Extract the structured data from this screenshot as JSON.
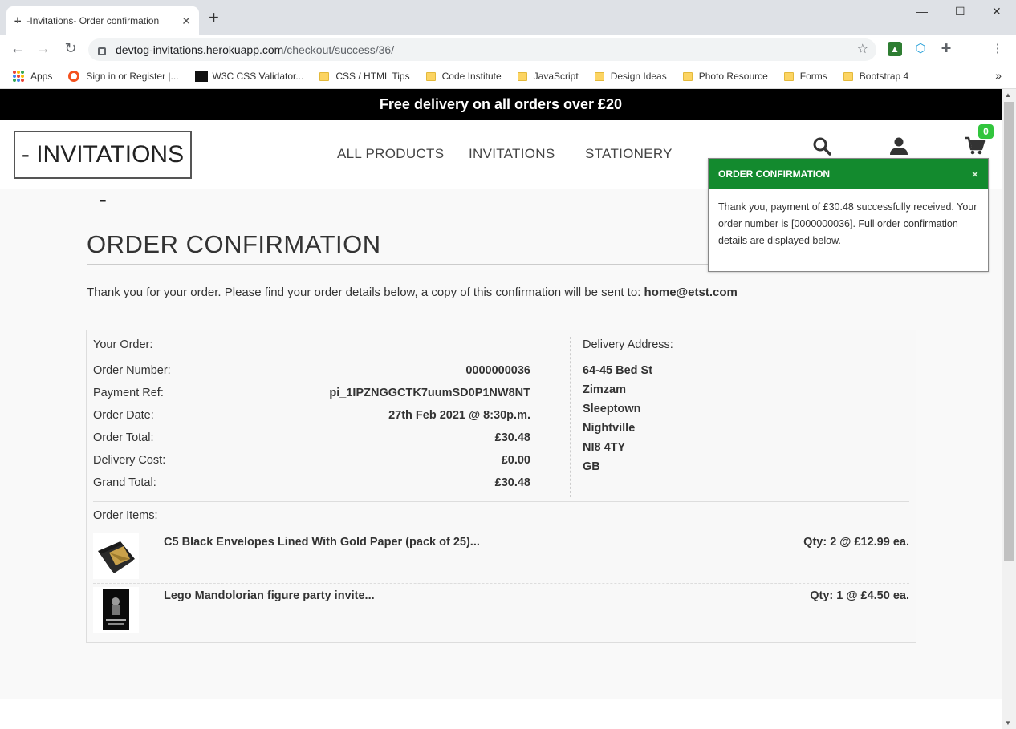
{
  "browser": {
    "tab_favicon": "-I-",
    "tab_title": "-Invitations- Order confirmation",
    "url_domain": "devtog-invitations.herokuapp.com",
    "url_path": "/checkout/success/36/",
    "bookmarks": [
      {
        "label": "Apps",
        "icon": "apps-grid-icon"
      },
      {
        "label": "Sign in or Register |...",
        "icon": "ring-icon"
      },
      {
        "label": "W3C CSS Validator...",
        "icon": "w3c-icon"
      },
      {
        "label": "CSS / HTML Tips",
        "icon": "folder-icon"
      },
      {
        "label": "Code Institute",
        "icon": "folder-icon"
      },
      {
        "label": "JavaScript",
        "icon": "folder-icon"
      },
      {
        "label": "Design Ideas",
        "icon": "folder-icon"
      },
      {
        "label": "Photo Resource",
        "icon": "folder-icon"
      },
      {
        "label": "Forms",
        "icon": "folder-icon"
      },
      {
        "label": "Bootstrap 4",
        "icon": "folder-icon"
      }
    ]
  },
  "site": {
    "banner": "Free delivery on all orders over £20",
    "logo": "- INVITATIONS -",
    "nav": [
      "ALL PRODUCTS",
      "INVITATIONS",
      "STATIONERY"
    ],
    "cart_count": "0"
  },
  "toast": {
    "title": "ORDER CONFIRMATION",
    "close": "×",
    "body": "Thank you, payment of £30.48 successfully received. Your order number is [0000000036]. Full order confirmation details are displayed below."
  },
  "page": {
    "heading": "ORDER CONFIRMATION",
    "intro": "Thank you for your order. Please find your order details below, a copy of this confirmation will be sent to: ",
    "email": "home@etst.com"
  },
  "order": {
    "section_label": "Your Order:",
    "rows": [
      {
        "label": "Order Number:",
        "value": "0000000036"
      },
      {
        "label": "Payment Ref:",
        "value": "pi_1IPZNGGCTK7uumSD0P1NW8NT"
      },
      {
        "label": "Order Date:",
        "value": "27th Feb 2021 @ 8:30p.m."
      },
      {
        "label": "Order Total:",
        "value": "£30.48"
      },
      {
        "label": "Delivery Cost:",
        "value": "£0.00"
      },
      {
        "label": "Grand Total:",
        "value": "£30.48"
      }
    ]
  },
  "delivery": {
    "label": "Delivery Address:",
    "lines": [
      "64-45 Bed St",
      "Zimzam",
      "Sleeptown",
      "Nightville",
      "NI8 4TY",
      "GB"
    ]
  },
  "items": {
    "label": "Order Items:",
    "list": [
      {
        "name": "C5 Black Envelopes Lined With Gold Paper (pack of 25)...",
        "qty": "Qty: 2 @ £12.99 ea."
      },
      {
        "name": "Lego Mandolorian figure party invite...",
        "qty": "Qty: 1 @ £4.50 ea."
      }
    ]
  },
  "colors": {
    "toast_header": "#138a2e",
    "badge": "#31c53d",
    "banner": "#000000"
  }
}
